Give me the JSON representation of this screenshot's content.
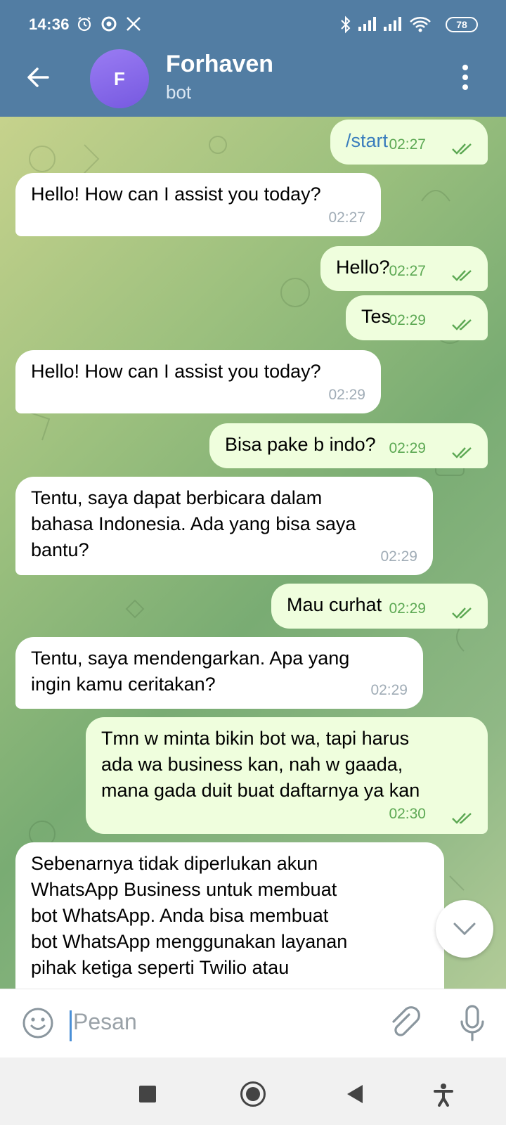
{
  "status_bar": {
    "time": "14:36",
    "battery": "78"
  },
  "header": {
    "avatar_letter": "F",
    "title": "Forhaven",
    "subtitle": "bot"
  },
  "messages": [
    {
      "dir": "out",
      "text": "/start",
      "time": "02:27",
      "is_command": true
    },
    {
      "dir": "in",
      "text": "Hello! How can I assist you today?",
      "time": "02:27"
    },
    {
      "dir": "out",
      "text": "Hello?",
      "time": "02:27"
    },
    {
      "dir": "out",
      "text": "Tes",
      "time": "02:29"
    },
    {
      "dir": "in",
      "text": "Hello! How can I assist you today?",
      "time": "02:29"
    },
    {
      "dir": "out",
      "text": "Bisa pake b indo?",
      "time": "02:29"
    },
    {
      "dir": "in",
      "lines": [
        "Tentu, saya dapat berbicara dalam",
        "bahasa Indonesia. Ada yang bisa saya",
        "bantu?"
      ],
      "time": "02:29"
    },
    {
      "dir": "out",
      "text": "Mau curhat",
      "time": "02:29"
    },
    {
      "dir": "in",
      "lines": [
        "Tentu, saya mendengarkan. Apa yang",
        "ingin kamu ceritakan?"
      ],
      "time": "02:29"
    },
    {
      "dir": "out",
      "lines": [
        "Tmn w minta bikin bot wa, tapi harus",
        "ada wa business kan, nah w gaada,",
        "mana gada duit buat daftarnya ya kan"
      ],
      "time": "02:30"
    },
    {
      "dir": "in",
      "lines": [
        "Sebenarnya tidak diperlukan akun",
        "WhatsApp Business untuk membuat",
        "bot WhatsApp. Anda bisa membuat",
        "bot WhatsApp menggunakan layanan",
        "pihak ketiga seperti Twilio atau"
      ]
    }
  ],
  "composer": {
    "placeholder": "Pesan"
  },
  "icons": {
    "back": "arrow-left-icon",
    "menu": "more-vertical-icon",
    "emoji": "smile-icon",
    "attach": "paperclip-icon",
    "mic": "microphone-icon",
    "scroll_down": "chevron-down-icon",
    "read": "double-check-icon"
  },
  "colors": {
    "header": "#527da3",
    "outgoing_bubble": "#effedd",
    "incoming_bubble": "#ffffff",
    "tick": "#5ca853",
    "avatar": "#8a6ef0"
  }
}
